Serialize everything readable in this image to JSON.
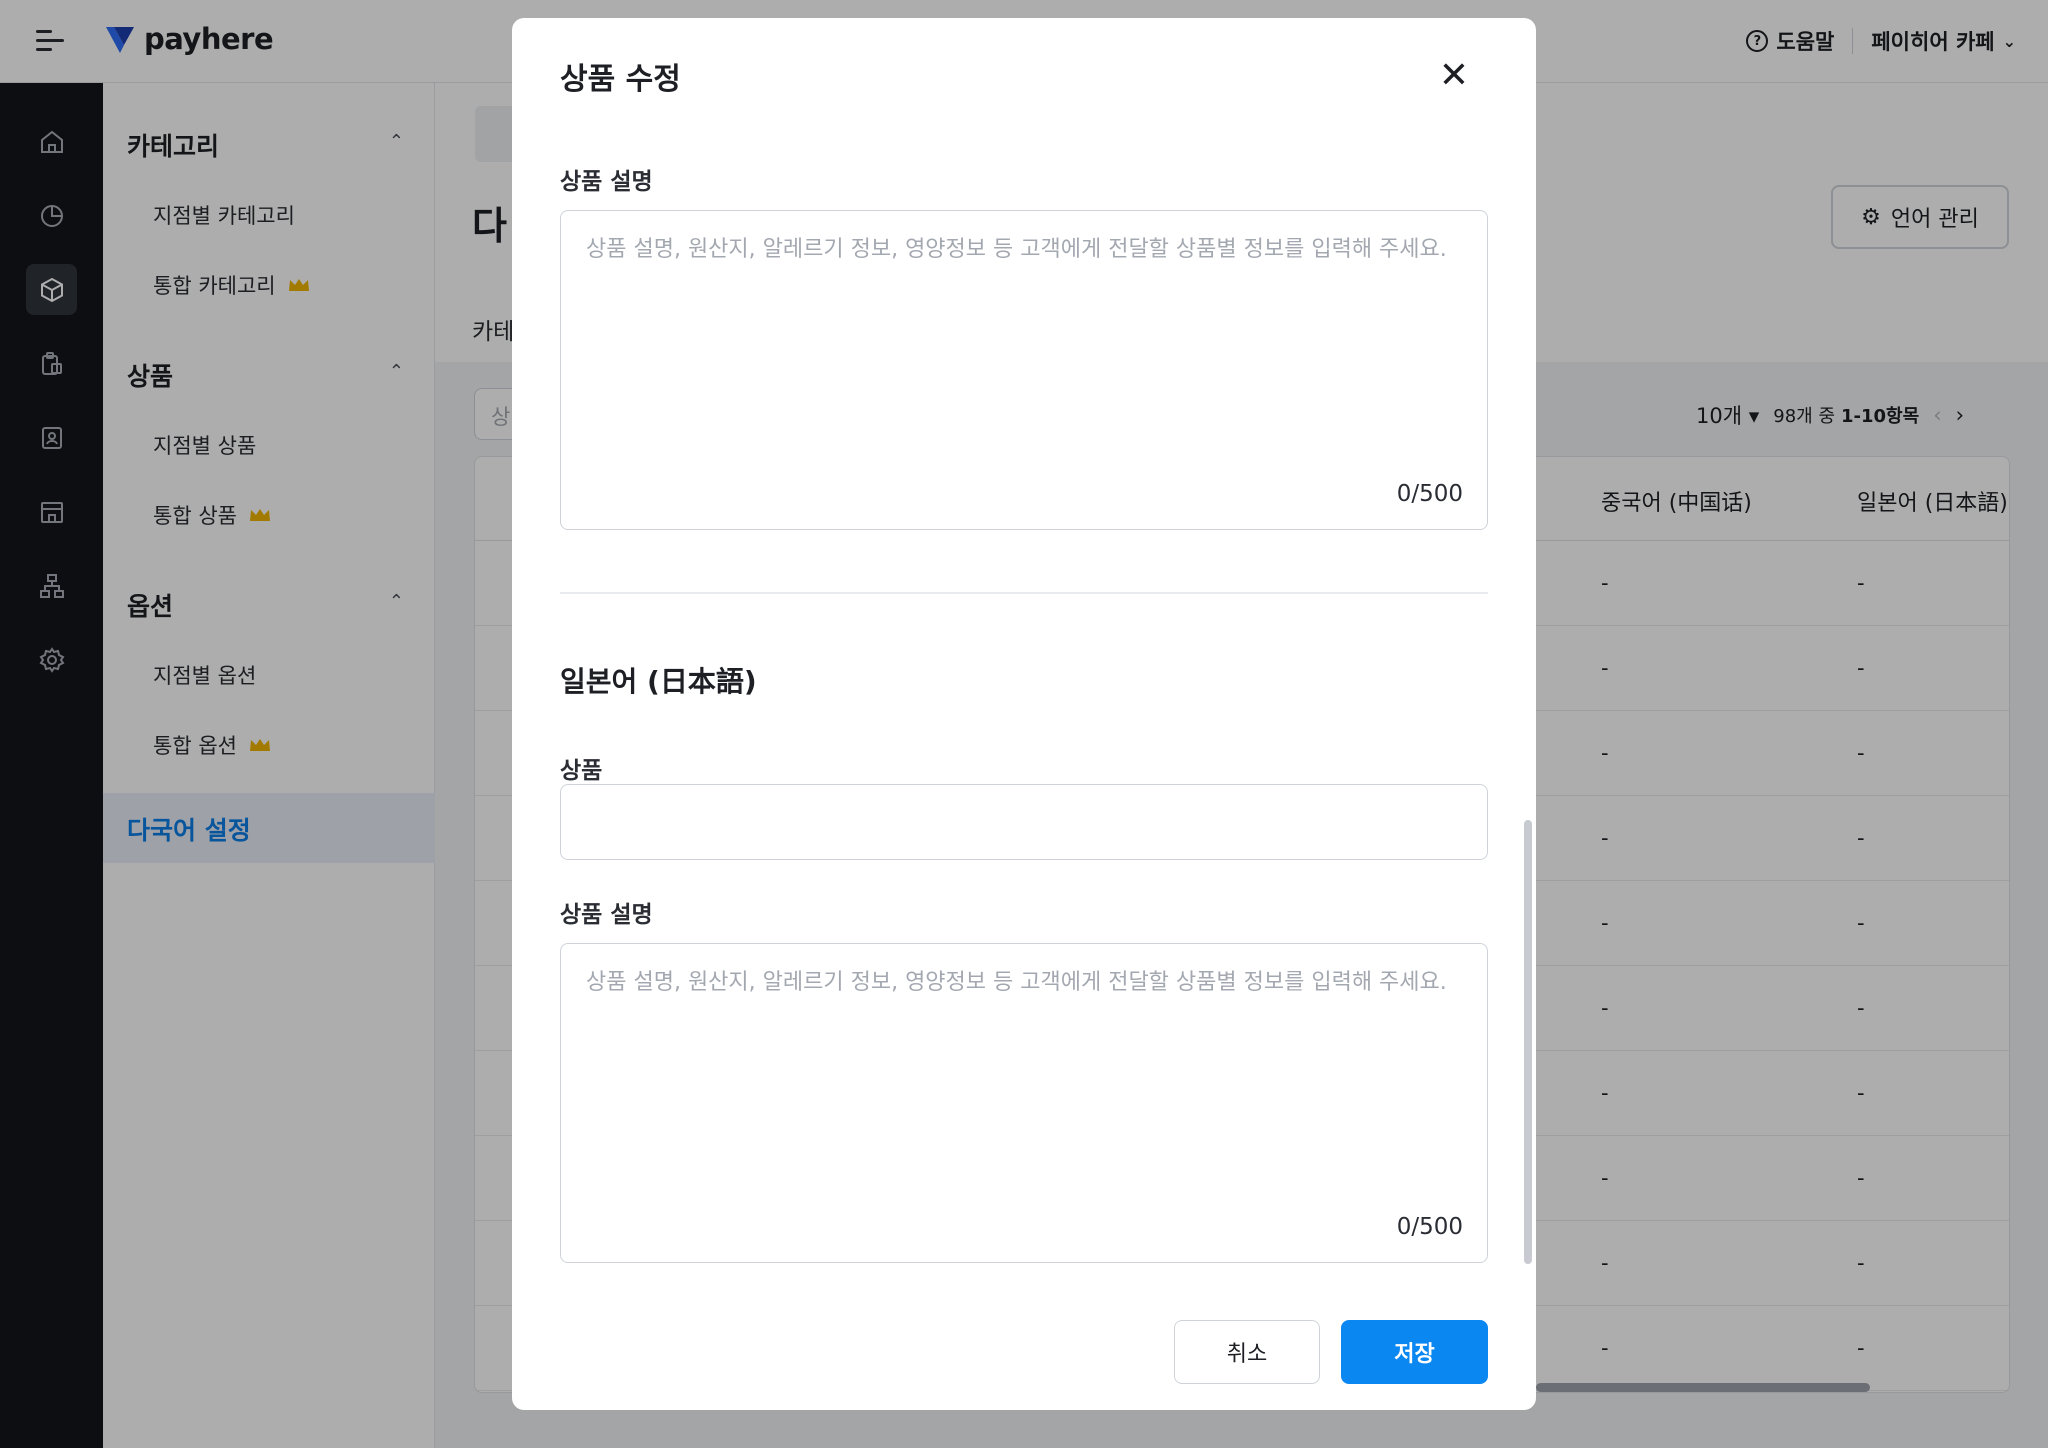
{
  "app": {
    "brand": "payhere",
    "help_label": "도움말",
    "store_name": "페이히어 카페",
    "store_chevron": "⌄"
  },
  "sidebar": {
    "sections": [
      {
        "title": "카테고리",
        "items": [
          {
            "label": "지점별 카테고리",
            "premium": false
          },
          {
            "label": "통합 카테고리",
            "premium": true
          }
        ]
      },
      {
        "title": "상품",
        "items": [
          {
            "label": "지점별 상품",
            "premium": false
          },
          {
            "label": "통합 상품",
            "premium": true
          }
        ]
      },
      {
        "title": "옵션",
        "items": [
          {
            "label": "지점별 옵션",
            "premium": false
          },
          {
            "label": "통합 옵션",
            "premium": true
          }
        ]
      }
    ],
    "active_item": "다국어 설정",
    "crown_color": "#f0b400"
  },
  "page": {
    "title_partial": "다",
    "sub_partial": "카테",
    "search_partial": "상",
    "lang_manage_button": "언어 관리",
    "pager": {
      "page_size": "10개",
      "range_prefix": "98개 중",
      "range": "1-10항목",
      "prev": "‹",
      "next": "›"
    },
    "table": {
      "columns": [
        "중국어 (中国话)",
        "일본어 (日本語)"
      ],
      "rows": [
        [
          "-",
          "-"
        ],
        [
          "-",
          "-"
        ],
        [
          "-",
          "-"
        ],
        [
          "-",
          "-"
        ],
        [
          "-",
          "-"
        ],
        [
          "-",
          "-"
        ],
        [
          "-",
          "-"
        ],
        [
          "-",
          "-"
        ],
        [
          "-",
          "-"
        ],
        [
          "-",
          "-"
        ]
      ]
    }
  },
  "modal": {
    "title": "상품 수정",
    "close_glyph": "✕",
    "first_description": {
      "label": "상품 설명",
      "placeholder": "상품 설명, 원산지, 알레르기 정보, 영양정보 등 고객에게 전달할 상품별 정보를 입력해 주세요.",
      "counter": "0/500"
    },
    "japanese": {
      "section_title": "일본어 (日本語)",
      "product_label": "상품",
      "product_value": "",
      "description_label": "상품 설명",
      "description_placeholder": "상품 설명, 원산지, 알레르기 정보, 영양정보 등 고객에게 전달할 상품별 정보를 입력해 주세요.",
      "counter": "0/500"
    },
    "cancel_label": "취소",
    "save_label": "저장"
  },
  "colors": {
    "accent": "#0b87f2",
    "active_text": "#0b7ee8",
    "rail_bg": "#14161b"
  }
}
